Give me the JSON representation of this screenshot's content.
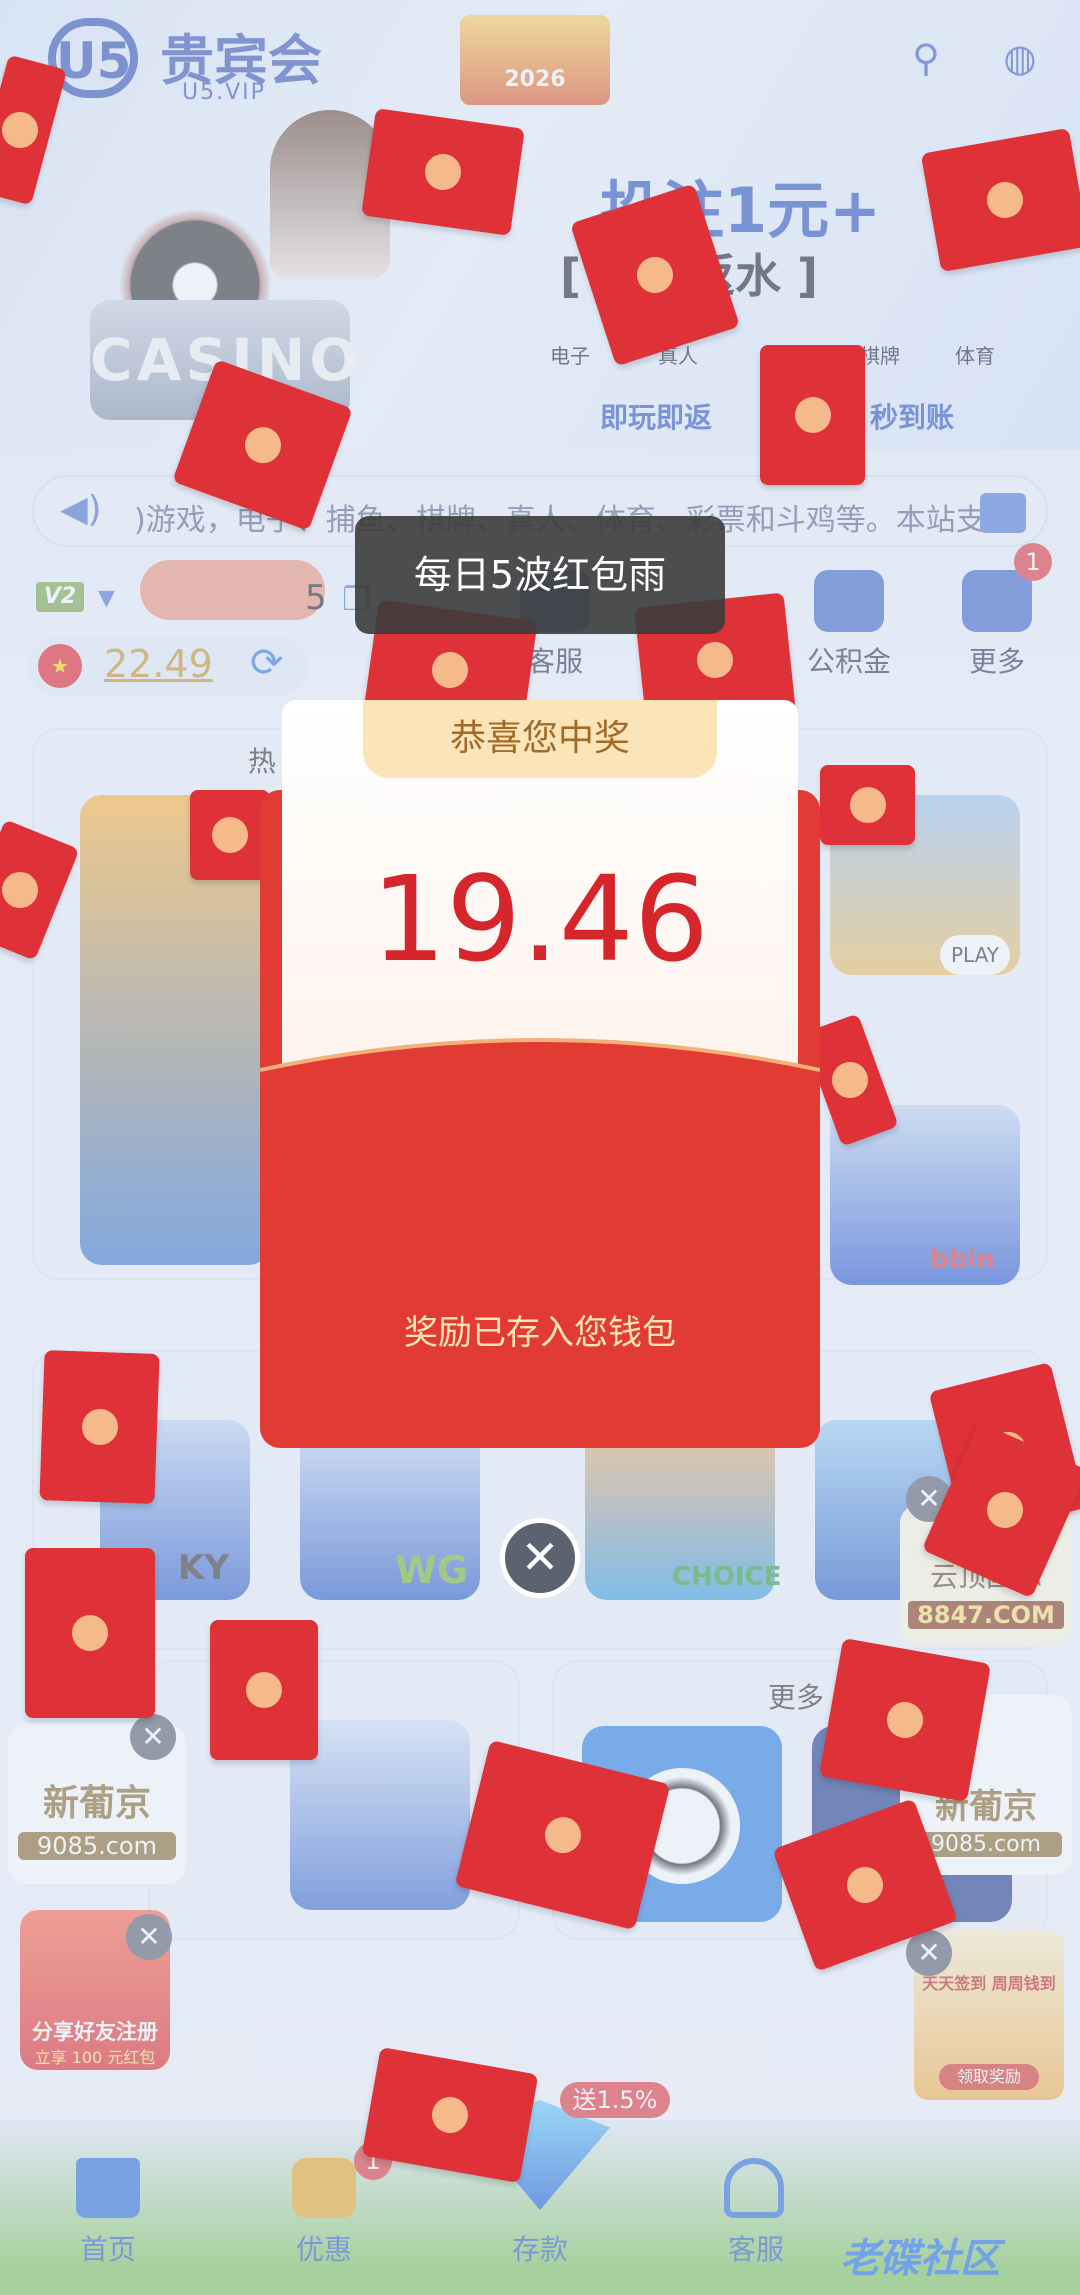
{
  "header": {
    "logo_mark": "U5",
    "logo_name": "贵宾会",
    "logo_sub": "U5.VIP",
    "event_badge": "2026"
  },
  "promo": {
    "title": "投注1元+",
    "subtitle": "[ 时时返水 ]",
    "categories": [
      "电子",
      "真人",
      "棋牌",
      "体育"
    ],
    "footer": "即玩即返",
    "footer_tail": "秒到账"
  },
  "marquee": {
    "text": ")游戏，电子、捕鱼、棋牌、真人、体育、彩票和斗鸡等。本站支持"
  },
  "account": {
    "vip_level": "V2",
    "user_id_suffix": "5",
    "balance": "22.49"
  },
  "quick_actions": [
    {
      "label": "客服"
    },
    {
      "label": "公积金"
    },
    {
      "label": "更多",
      "badge": "1"
    }
  ],
  "sections": {
    "hot_heading": "热",
    "more_heading": "更多",
    "brand_ky": "KY",
    "brand_wg": "WG",
    "brand_choice": "CHOICE",
    "brand_bbin": "bbin",
    "play_label": "PLAY"
  },
  "ads": {
    "site1_name": "新葡京",
    "site1_url": "9085.com",
    "site2_name": "云顶国际",
    "site2_url": "8847.COM",
    "share_title": "分享好友注册",
    "share_sub": "立享 100 元红包",
    "checkin_title": "天天签到 周周钱到",
    "checkin_button": "领取奖励"
  },
  "toast": {
    "text": "每日5波红包雨"
  },
  "reward_modal": {
    "header": "恭喜您中奖",
    "amount": "19.46",
    "message": "奖励已存入您钱包",
    "close_symbol": "✕"
  },
  "bottom_nav": {
    "items": [
      {
        "label": "首页"
      },
      {
        "label": "优惠",
        "badge": "1"
      },
      {
        "label": "存款",
        "tag": "送1.5%"
      },
      {
        "label": "客服"
      }
    ],
    "watermark": "老碟社区"
  },
  "colors": {
    "brand_blue": "#3453b8",
    "envelope_red": "#de3138",
    "amount_red": "#d6252b",
    "balance_gold": "#c9962b"
  }
}
